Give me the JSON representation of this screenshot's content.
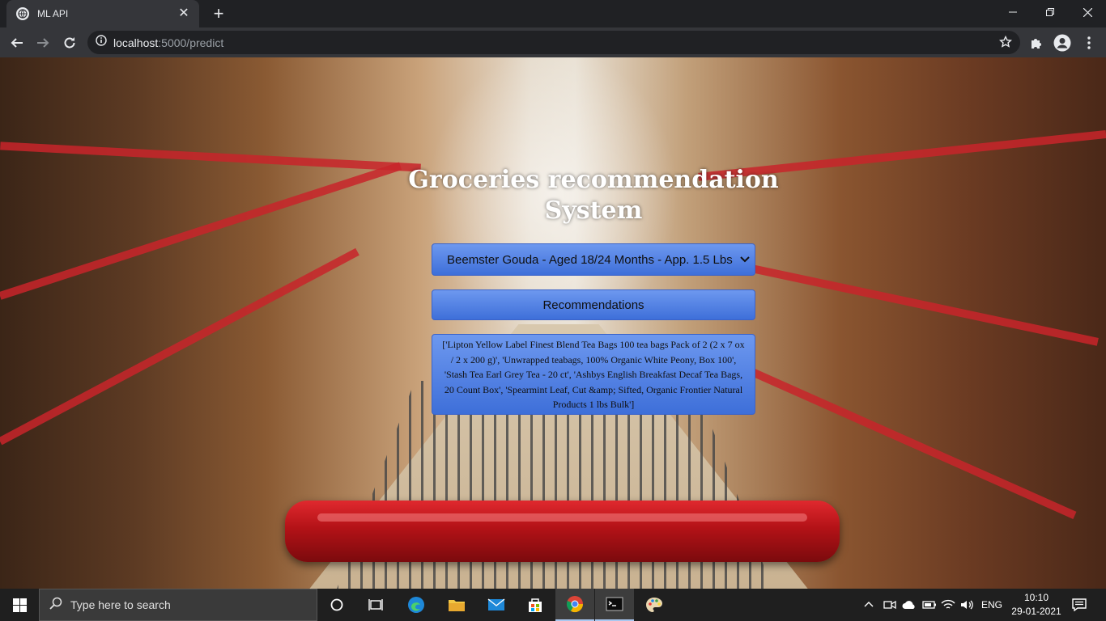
{
  "browser": {
    "tab_title": "ML API",
    "new_tab": "+",
    "url_host": "localhost",
    "url_rest": ":5000/predict"
  },
  "app": {
    "title": "Groceries recommendation System",
    "selected_product": "Beemster Gouda - Aged 18/24 Months - App. 1.5 Lbs",
    "button_label": "Recommendations",
    "result": "['Lipton Yellow Label Finest Blend Tea Bags 100 tea bags Pack of 2 (2 x 7 ox / 2 x 200 g)', 'Unwrapped teabags, 100% Organic White Peony, Box 100', 'Stash Tea Earl Grey Tea - 20 ct', 'Ashbys English Breakfast Decaf Tea Bags, 20 Count Box', 'Spearmint Leaf, Cut &amp; Sifted, Organic Frontier Natural Products 1 lbs Bulk']"
  },
  "taskbar": {
    "search_placeholder": "Type here to search",
    "language": "ENG",
    "time": "10:10",
    "date": "29-01-2021"
  },
  "colors": {
    "button_top": "#6d98ef",
    "button_bottom": "#3e6fd9",
    "cart_handle": "#c41a1f"
  }
}
